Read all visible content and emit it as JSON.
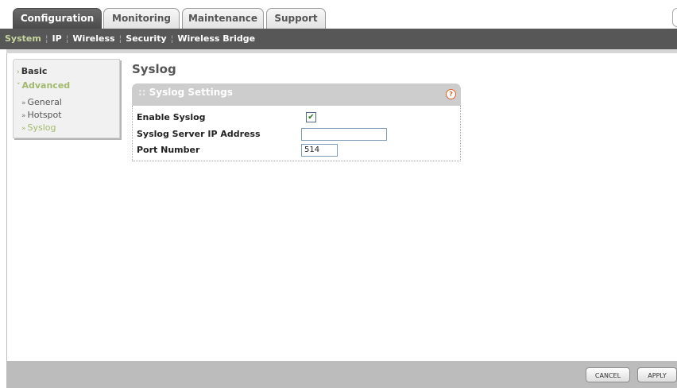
{
  "tabs": [
    {
      "label": "Configuration",
      "active": true
    },
    {
      "label": "Monitoring",
      "active": false
    },
    {
      "label": "Maintenance",
      "active": false
    },
    {
      "label": "Support",
      "active": false
    }
  ],
  "subnav": {
    "items": [
      "System",
      "IP",
      "Wireless",
      "Security",
      "Wireless Bridge"
    ],
    "active_index": 0
  },
  "leftmenu": {
    "basic": "Basic",
    "advanced": "Advanced",
    "items": [
      "General",
      "Hotspot",
      "Syslog"
    ],
    "active_item": "Syslog"
  },
  "page_title": "Syslog",
  "panel": {
    "title": "Syslog Settings",
    "help_icon": "help-icon",
    "fields": {
      "enable_syslog_label": "Enable Syslog",
      "enable_syslog_checked": true,
      "server_ip_label": "Syslog Server IP Address",
      "server_ip_value": "",
      "port_label": "Port Number",
      "port_value": "514"
    }
  },
  "buttons": {
    "cancel": "CANCEL",
    "apply": "APPLY"
  },
  "colors": {
    "active_tab": "#555555",
    "subnav_bg": "#575757",
    "accent_green": "#a2b96c",
    "help_orange": "#e06024"
  }
}
